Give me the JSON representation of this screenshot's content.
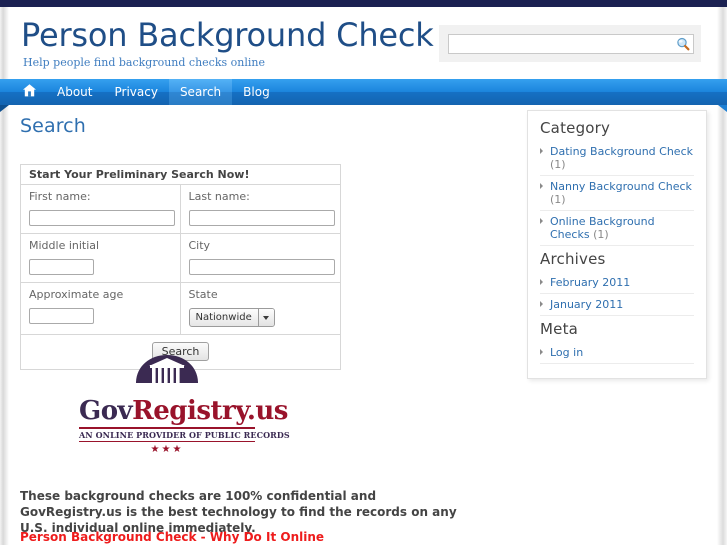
{
  "header": {
    "site_title": "Person Background Check",
    "tagline": "Help people find background checks online",
    "search": {
      "value": "",
      "placeholder": "",
      "icon": "magnifier-icon"
    }
  },
  "nav": {
    "home_icon": "home-icon",
    "items": [
      {
        "label": "About",
        "active": false
      },
      {
        "label": "Privacy",
        "active": false
      },
      {
        "label": "Search",
        "active": true
      },
      {
        "label": "Blog",
        "active": false
      }
    ]
  },
  "main": {
    "page_title": "Search",
    "form": {
      "heading": "Start Your Preliminary Search Now!",
      "fields": {
        "first_name_label": "First name:",
        "first_name_value": "",
        "last_name_label": "Last name:",
        "last_name_value": "",
        "middle_initial_label": "Middle initial",
        "middle_initial_value": "",
        "city_label": "City",
        "city_value": "",
        "approximate_age_label": "Approximate age",
        "approximate_age_value": "",
        "state_label": "State",
        "state_selected": "Nationwide"
      },
      "submit_label": "Search"
    },
    "logo": {
      "word_part1": "Gov",
      "word_part2": "Registry.us",
      "subtitle": "AN ONLINE PROVIDER OF PUBLIC RECORDS",
      "stars": "★★★",
      "icon": "capitol-dome-icon"
    },
    "paragraph": "These background checks are 100% confidential and GovRegistry.us is the best technology to find the records on any U.S. individual online immediately.",
    "red_heading": "Person Background Check - Why Do It Online"
  },
  "sidebar": {
    "category": {
      "title": "Category",
      "items": [
        {
          "label": "Dating Background Check",
          "count": "(1)"
        },
        {
          "label": "Nanny Background Check",
          "count": "(1)"
        },
        {
          "label": "Online Background Checks",
          "count": "(1)"
        }
      ]
    },
    "archives": {
      "title": "Archives",
      "items": [
        {
          "label": "February 2011"
        },
        {
          "label": "January 2011"
        }
      ]
    },
    "meta": {
      "title": "Meta",
      "items": [
        {
          "label": "Log in"
        }
      ]
    }
  },
  "colors": {
    "top_strip": "#1b2152",
    "title_blue": "#1f4e87",
    "nav_blue": "#1c85dd",
    "link_blue": "#2f6faf",
    "red": "#ee1c1c",
    "logo_purple": "#3b2a52",
    "logo_red": "#99132b"
  }
}
